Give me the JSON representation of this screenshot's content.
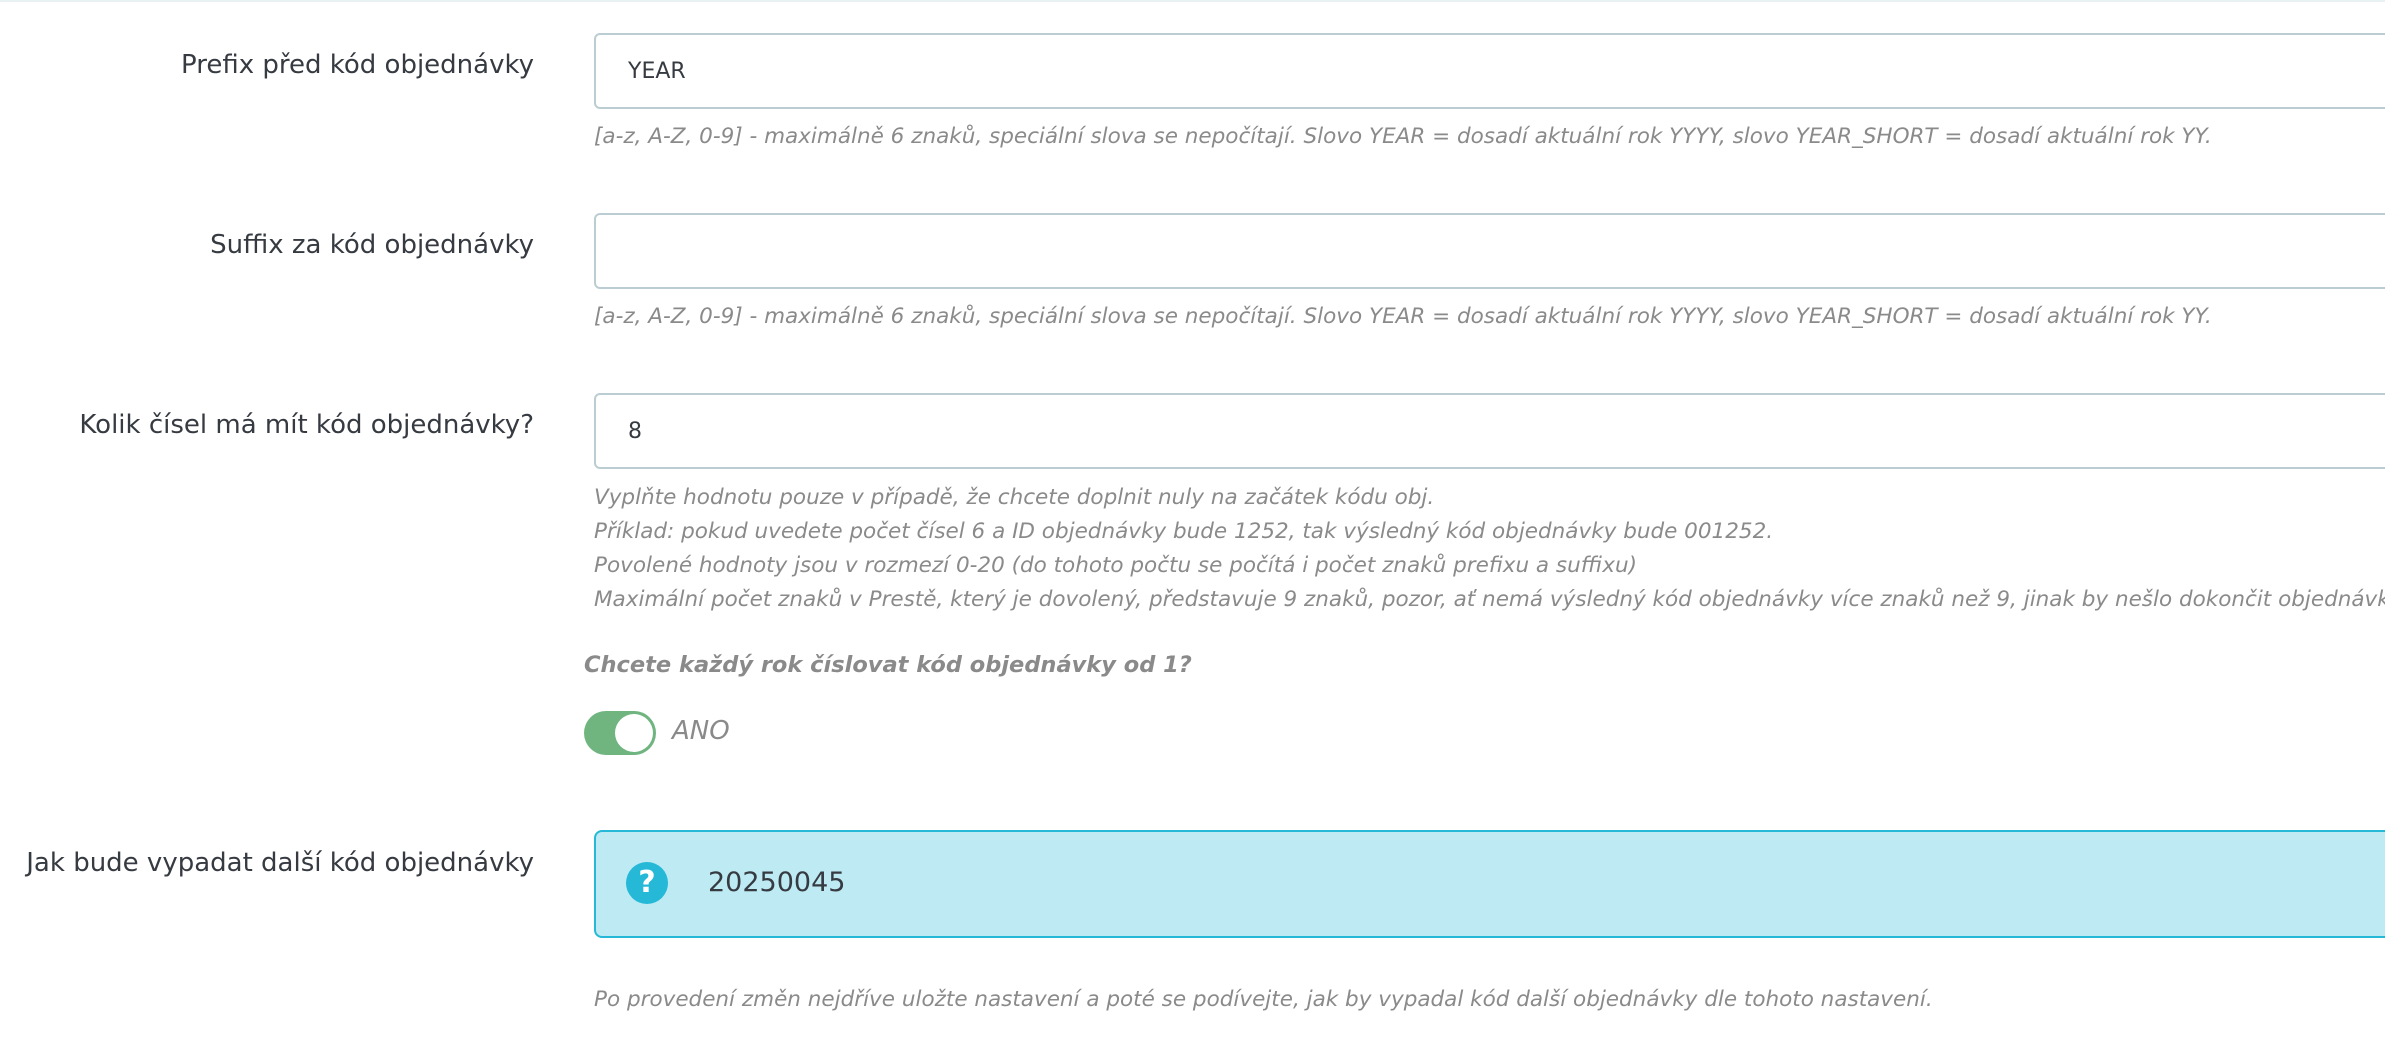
{
  "fields": {
    "prefix": {
      "label": "Prefix před kód objednávky",
      "value": "YEAR",
      "help": "[a-z, A-Z, 0-9] - maximálně 6 znaků, speciální slova se nepočítají. Slovo YEAR = dosadí aktuální rok YYYY, slovo YEAR_SHORT = dosadí aktuální rok YY."
    },
    "suffix": {
      "label": "Suffix za kód objednávky",
      "value": "",
      "help": "[a-z, A-Z, 0-9] - maximálně 6 znaků, speciální slova se nepočítají. Slovo YEAR = dosadí aktuální rok YYYY, slovo YEAR_SHORT = dosadí aktuální rok YY."
    },
    "digits": {
      "label": "Kolik čísel má mít kód objednávky?",
      "value": "8",
      "help_lines": [
        "Vyplňte hodnotu pouze v případě, že chcete doplnit nuly na začátek kódu obj.",
        "Příklad: pokud uvedete počet čísel 6 a ID objednávky bude 1252, tak výsledný kód objednávky bude 001252.",
        "Povolené hodnoty jsou v rozmezí 0-20 (do tohoto počtu se počítá i počet znaků prefixu a suffixu)",
        "Maximální počet znaků v Prestě, který je dovolený, představuje 9 znaků, pozor, ať nemá výsledný kód objednávky více znaků než 9, jinak by nešlo dokončit objednávku."
      ]
    },
    "yearly_reset": {
      "question": "Chcete každý rok číslovat kód objednávky od 1?",
      "enabled": true,
      "state_label": "ANO"
    },
    "next_code": {
      "label": "Jak bude vypadat další kód objednávky",
      "icon": "question-circle-icon",
      "value": "20250045",
      "help": "Po provedení změn nejdříve uložte nastavení a poté se podívejte, jak by vypadal kód další objednávky dle tohoto nastavení."
    }
  },
  "colors": {
    "toggle_on": "#70b580",
    "info_background": "#beeaf3",
    "info_border": "#25b9d7",
    "input_border": "#bbcdd2"
  }
}
